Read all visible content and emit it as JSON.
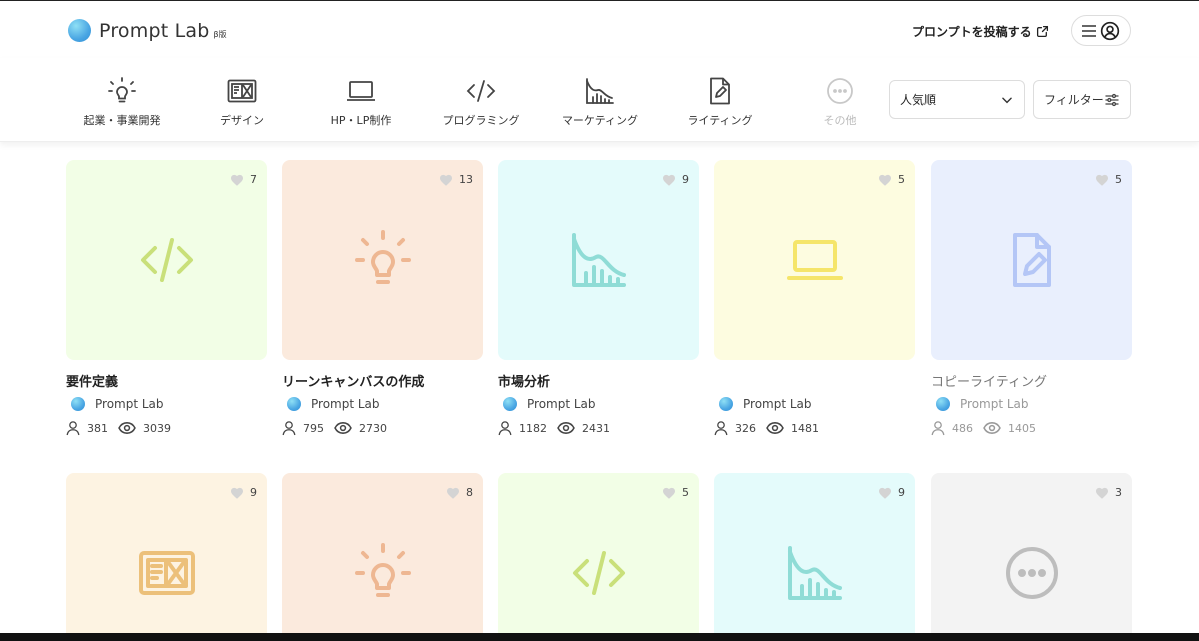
{
  "header": {
    "logo_text": "Prompt Lab",
    "logo_beta": "β版",
    "post_link": "プロンプトを投稿する"
  },
  "categories": [
    {
      "label": "起業・事業開発",
      "icon": "lightbulb-icon"
    },
    {
      "label": "デザイン",
      "icon": "design-image-icon"
    },
    {
      "label": "HP・LP制作",
      "icon": "laptop-icon"
    },
    {
      "label": "プログラミング",
      "icon": "code-icon"
    },
    {
      "label": "マーケティング",
      "icon": "chart-icon"
    },
    {
      "label": "ライティング",
      "icon": "document-pen-icon"
    },
    {
      "label": "その他",
      "icon": "more-icon"
    }
  ],
  "sort": {
    "selected": "人気順"
  },
  "filter": {
    "label": "フィルター"
  },
  "cards": [
    {
      "title": "要件定義",
      "likes": "7",
      "author": "Prompt Lab",
      "users": "381",
      "views": "3039",
      "bg": "#f2fee6",
      "color": "#c9e07a",
      "icon": "code-icon"
    },
    {
      "title": "リーンキャンバスの作成",
      "likes": "13",
      "author": "Prompt Lab",
      "users": "795",
      "views": "2730",
      "bg": "#fbeadd",
      "color": "#eeb792",
      "icon": "lightbulb-icon"
    },
    {
      "title": "市場分析",
      "likes": "9",
      "author": "Prompt Lab",
      "users": "1182",
      "views": "2431",
      "bg": "#e4fbfb",
      "color": "#8fdcd6",
      "icon": "chart-icon"
    },
    {
      "title": "",
      "likes": "5",
      "author": "Prompt Lab",
      "users": "326",
      "views": "1481",
      "bg": "#fdfce0",
      "color": "#f5e56a",
      "icon": "laptop-icon"
    },
    {
      "title": "コピーライティング",
      "likes": "5",
      "author": "Prompt Lab",
      "users": "486",
      "views": "1405",
      "bg": "#e9effd",
      "color": "#b4c6f6",
      "icon": "document-pen-icon"
    },
    {
      "title": "",
      "likes": "9",
      "author": "",
      "users": "",
      "views": "",
      "bg": "#fdf3e2",
      "color": "#ecc07a",
      "icon": "design-image-icon"
    },
    {
      "title": "",
      "likes": "8",
      "author": "",
      "users": "",
      "views": "",
      "bg": "#fbeadd",
      "color": "#eeb792",
      "icon": "lightbulb-icon"
    },
    {
      "title": "",
      "likes": "5",
      "author": "",
      "users": "",
      "views": "",
      "bg": "#f2fee6",
      "color": "#c9e07a",
      "icon": "code-icon"
    },
    {
      "title": "",
      "likes": "9",
      "author": "",
      "users": "",
      "views": "",
      "bg": "#e4fbfb",
      "color": "#8fdcd6",
      "icon": "chart-icon"
    },
    {
      "title": "",
      "likes": "3",
      "author": "",
      "users": "",
      "views": "",
      "bg": "#f3f3f3",
      "color": "#bdbdbd",
      "icon": "more-icon"
    }
  ]
}
